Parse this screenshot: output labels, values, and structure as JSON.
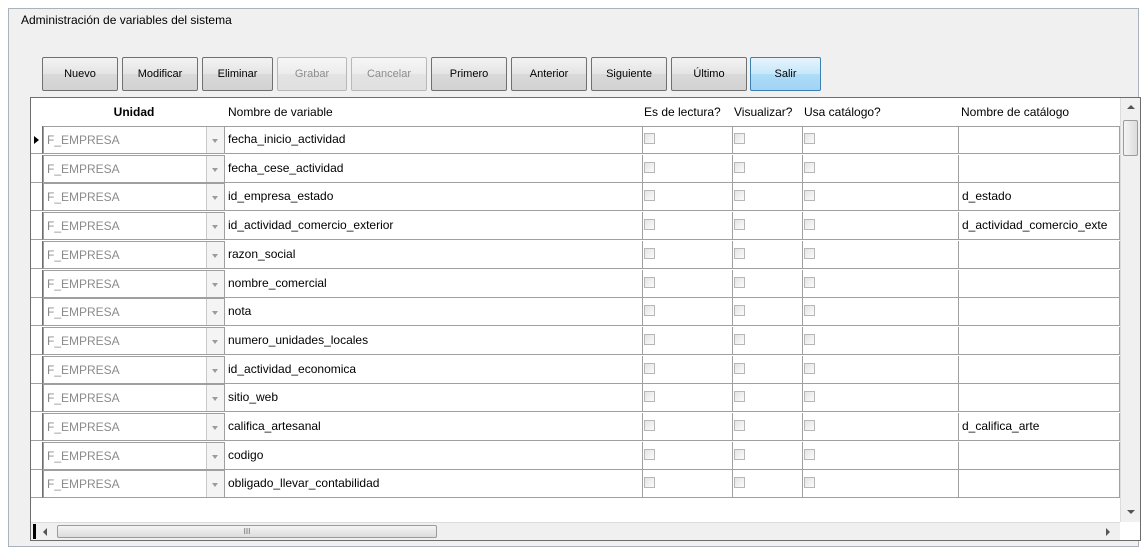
{
  "window": {
    "title": "Administración de variables del sistema"
  },
  "toolbar": {
    "buttons": [
      {
        "label": "Nuevo",
        "state": "enabled"
      },
      {
        "label": "Modificar",
        "state": "enabled"
      },
      {
        "label": "Eliminar",
        "state": "enabled"
      },
      {
        "label": "Grabar",
        "state": "disabled"
      },
      {
        "label": "Cancelar",
        "state": "disabled"
      },
      {
        "label": "Primero",
        "state": "enabled"
      },
      {
        "label": "Anterior",
        "state": "enabled"
      },
      {
        "label": "Siguiente",
        "state": "enabled"
      },
      {
        "label": "Último",
        "state": "enabled"
      },
      {
        "label": "Salir",
        "state": "highlighted"
      }
    ]
  },
  "grid": {
    "columns": {
      "unidad": "Unidad",
      "nombre": "Nombre de variable",
      "lectura": "Es de lectura?",
      "visualizar": "Visualizar?",
      "catalogo": "Usa catálogo?",
      "nombre_catalogo": "Nombre de catálogo"
    },
    "current_row": 0,
    "rows": [
      {
        "unidad": "F_EMPRESA",
        "nombre": "fecha_inicio_actividad",
        "lectura": false,
        "visualizar": false,
        "catalogo": false,
        "nombre_catalogo": ""
      },
      {
        "unidad": "F_EMPRESA",
        "nombre": "fecha_cese_actividad",
        "lectura": false,
        "visualizar": false,
        "catalogo": false,
        "nombre_catalogo": ""
      },
      {
        "unidad": "F_EMPRESA",
        "nombre": "id_empresa_estado",
        "lectura": false,
        "visualizar": false,
        "catalogo": false,
        "nombre_catalogo": "d_estado"
      },
      {
        "unidad": "F_EMPRESA",
        "nombre": "id_actividad_comercio_exterior",
        "lectura": false,
        "visualizar": false,
        "catalogo": false,
        "nombre_catalogo": "d_actividad_comercio_exte"
      },
      {
        "unidad": "F_EMPRESA",
        "nombre": "razon_social",
        "lectura": false,
        "visualizar": false,
        "catalogo": false,
        "nombre_catalogo": ""
      },
      {
        "unidad": "F_EMPRESA",
        "nombre": "nombre_comercial",
        "lectura": false,
        "visualizar": false,
        "catalogo": false,
        "nombre_catalogo": ""
      },
      {
        "unidad": "F_EMPRESA",
        "nombre": "nota",
        "lectura": false,
        "visualizar": false,
        "catalogo": false,
        "nombre_catalogo": ""
      },
      {
        "unidad": "F_EMPRESA",
        "nombre": "numero_unidades_locales",
        "lectura": false,
        "visualizar": false,
        "catalogo": false,
        "nombre_catalogo": ""
      },
      {
        "unidad": "F_EMPRESA",
        "nombre": "id_actividad_economica",
        "lectura": false,
        "visualizar": false,
        "catalogo": false,
        "nombre_catalogo": ""
      },
      {
        "unidad": "F_EMPRESA",
        "nombre": "sitio_web",
        "lectura": false,
        "visualizar": false,
        "catalogo": false,
        "nombre_catalogo": ""
      },
      {
        "unidad": "F_EMPRESA",
        "nombre": "califica_artesanal",
        "lectura": false,
        "visualizar": false,
        "catalogo": false,
        "nombre_catalogo": "d_califica_arte"
      },
      {
        "unidad": "F_EMPRESA",
        "nombre": "codigo",
        "lectura": false,
        "visualizar": false,
        "catalogo": false,
        "nombre_catalogo": ""
      },
      {
        "unidad": "F_EMPRESA",
        "nombre": "obligado_llevar_contabilidad",
        "lectura": false,
        "visualizar": false,
        "catalogo": false,
        "nombre_catalogo": ""
      }
    ]
  },
  "scrollbar": {
    "h_thumb_glyph": "III"
  }
}
